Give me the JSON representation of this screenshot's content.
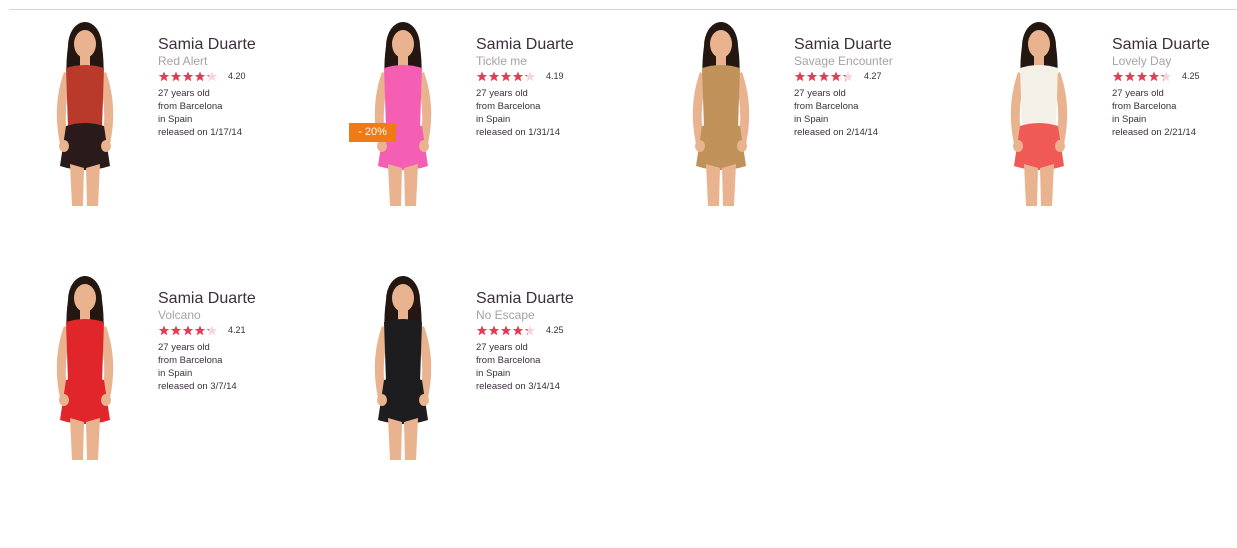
{
  "colors": {
    "star_full": "#e23d55",
    "star_empty": "#f6d6dc",
    "badge": "#f07b16"
  },
  "items": [
    {
      "model": "Samia Duarte",
      "title": "Red Alert",
      "rating_value": 4.2,
      "rating_text": "4.20",
      "age": "27 years old",
      "city": "from Barcelona",
      "country": "in Spain",
      "released": "released on 1/17/14",
      "outfit": [
        "#b93a2b",
        "#2a1a1a"
      ],
      "badge": null
    },
    {
      "model": "Samia Duarte",
      "title": "Tickle me",
      "rating_value": 4.19,
      "rating_text": "4.19",
      "age": "27 years old",
      "city": "from Barcelona",
      "country": "in Spain",
      "released": "released on 1/31/14",
      "outfit": [
        "#f45fb4",
        "#f45fb4"
      ],
      "badge": "- 20%"
    },
    {
      "model": "Samia Duarte",
      "title": "Savage Encounter",
      "rating_value": 4.27,
      "rating_text": "4.27",
      "age": "27 years old",
      "city": "from Barcelona",
      "country": "in Spain",
      "released": "released on 2/14/14",
      "outfit": [
        "#c0925a",
        "#c0925a"
      ],
      "badge": null
    },
    {
      "model": "Samia Duarte",
      "title": "Lovely Day",
      "rating_value": 4.25,
      "rating_text": "4.25",
      "age": "27 years old",
      "city": "from Barcelona",
      "country": "in Spain",
      "released": "released on 2/21/14",
      "outfit": [
        "#f3f0e8",
        "#f05a55"
      ],
      "badge": null
    },
    {
      "model": "Samia Duarte",
      "title": "Volcano",
      "rating_value": 4.21,
      "rating_text": "4.21",
      "age": "27 years old",
      "city": "from Barcelona",
      "country": "in Spain",
      "released": "released on 3/7/14",
      "outfit": [
        "#e0262b",
        "#e0262b"
      ],
      "badge": null
    },
    {
      "model": "Samia Duarte",
      "title": "No Escape",
      "rating_value": 4.25,
      "rating_text": "4.25",
      "age": "27 years old",
      "city": "from Barcelona",
      "country": "in Spain",
      "released": "released on 3/14/14",
      "outfit": [
        "#1d1d1f",
        "#1d1d1f"
      ],
      "badge": null
    }
  ]
}
